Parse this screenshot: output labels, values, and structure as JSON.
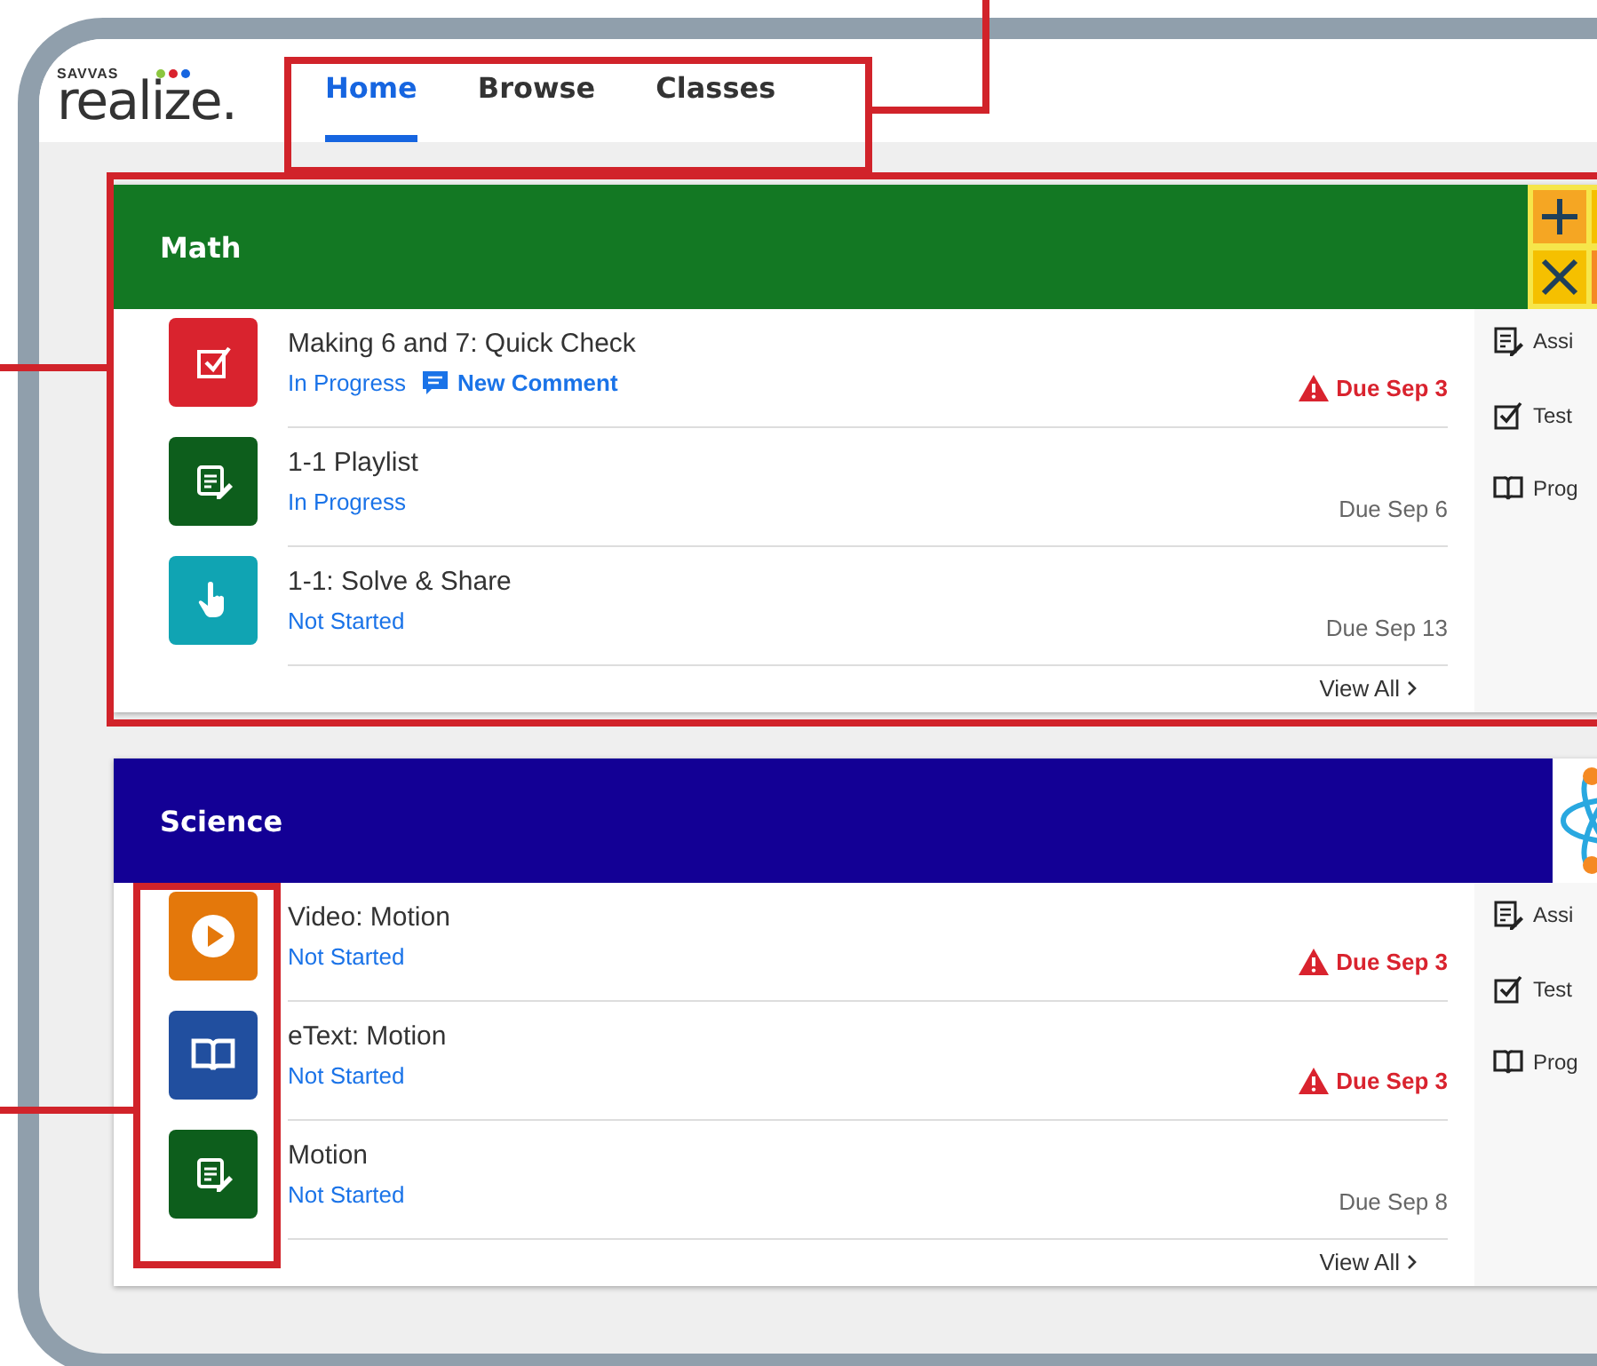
{
  "logo": {
    "brand": "SAVVAS",
    "name": "realize."
  },
  "nav": [
    {
      "label": "Home",
      "selected": true
    },
    {
      "label": "Browse",
      "selected": false
    },
    {
      "label": "Classes",
      "selected": false
    }
  ],
  "courses": [
    {
      "title": "Math",
      "color": "#137823",
      "kind": "math",
      "view_all": "View All",
      "items": [
        {
          "kind": "quiz",
          "title": "Making 6 and 7: Quick Check",
          "status": "In Progress",
          "comment": "New Comment",
          "due": "Due Sep 3",
          "overdue": true
        },
        {
          "kind": "playlist",
          "title": "1-1 Playlist",
          "status": "In Progress",
          "due": "Due Sep 6",
          "overdue": false
        },
        {
          "kind": "interactive",
          "title": "1-1: Solve & Share",
          "status": "Not Started",
          "due": "Due Sep 13",
          "overdue": false
        }
      ],
      "side_links": [
        {
          "kind": "assignments",
          "label": "Assi"
        },
        {
          "kind": "tests",
          "label": "Test"
        },
        {
          "kind": "program",
          "label": "Prog"
        }
      ]
    },
    {
      "title": "Science",
      "color": "#130095",
      "kind": "atom",
      "view_all": "View All",
      "items": [
        {
          "kind": "video",
          "title": "Video: Motion",
          "status": "Not Started",
          "due": "Due Sep 3",
          "overdue": true
        },
        {
          "kind": "etext",
          "title": "eText: Motion",
          "status": "Not Started",
          "due": "Due Sep 3",
          "overdue": true
        },
        {
          "kind": "playlist",
          "title": "Motion",
          "status": "Not Started",
          "due": "Due Sep 8",
          "overdue": false
        }
      ],
      "side_links": [
        {
          "kind": "assignments",
          "label": "Assi"
        },
        {
          "kind": "tests",
          "label": "Test"
        },
        {
          "kind": "program",
          "label": "Prog"
        }
      ]
    }
  ]
}
